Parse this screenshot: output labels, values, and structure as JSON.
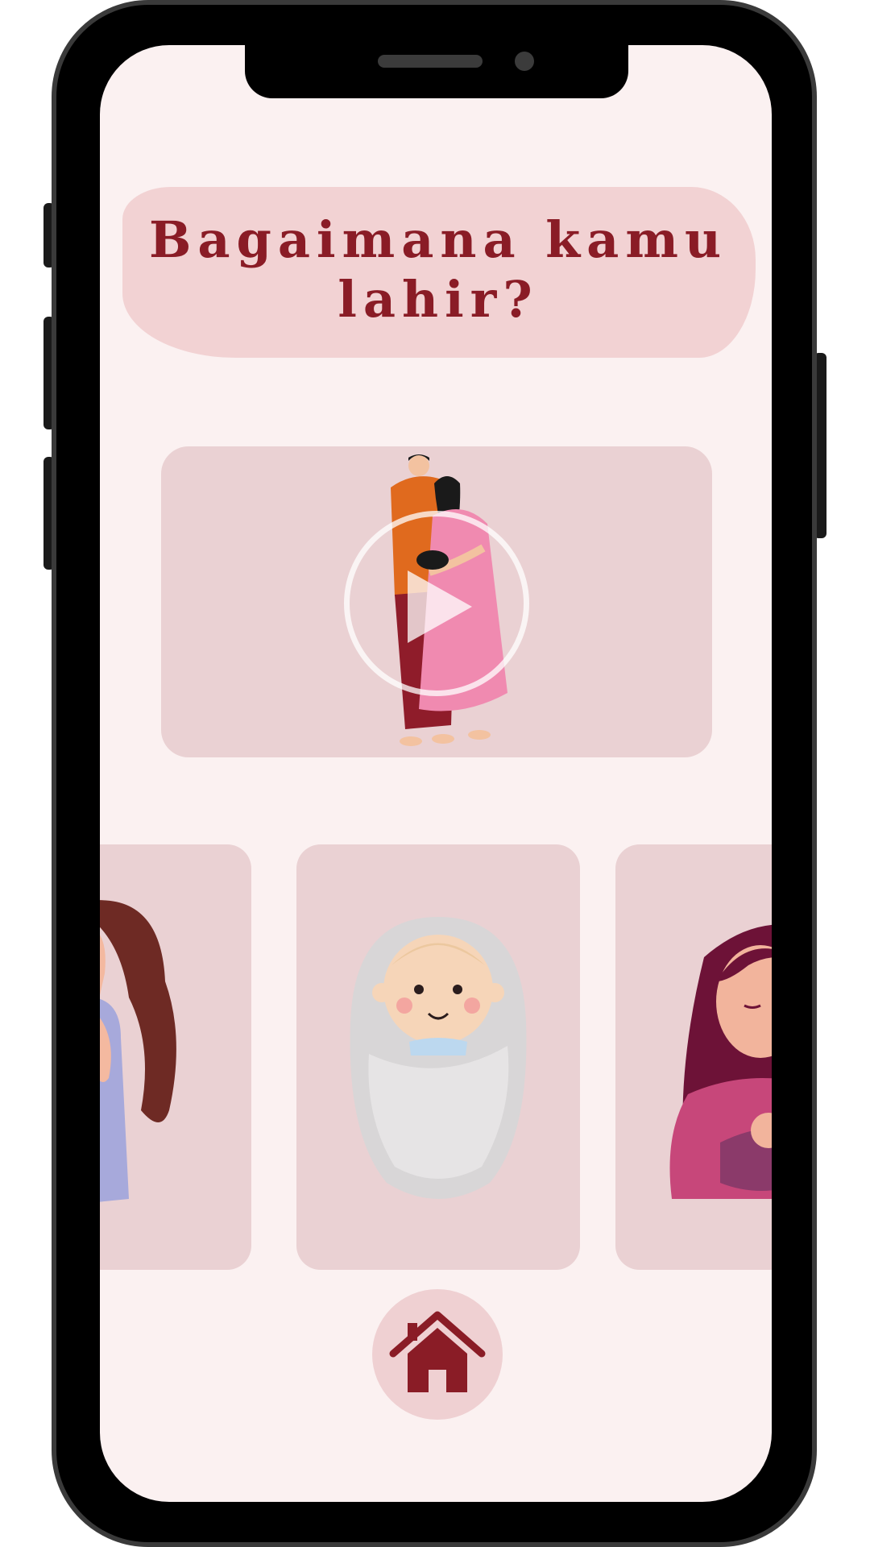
{
  "page": {
    "title": "Bagaimana kamu lahir?"
  },
  "video": {
    "play_icon": "play-icon"
  },
  "carousel": {
    "items": [
      {
        "icon": "woman-long-hair-illustration"
      },
      {
        "icon": "swaddled-baby-illustration"
      },
      {
        "icon": "mother-holding-baby-illustration"
      }
    ]
  },
  "nav": {
    "home_icon": "home-icon"
  },
  "colors": {
    "background": "#fbf1f1",
    "title_blob": "#f2d2d3",
    "card": "#ead1d3",
    "accent": "#8a1c26",
    "phone_frame": "#000000"
  }
}
